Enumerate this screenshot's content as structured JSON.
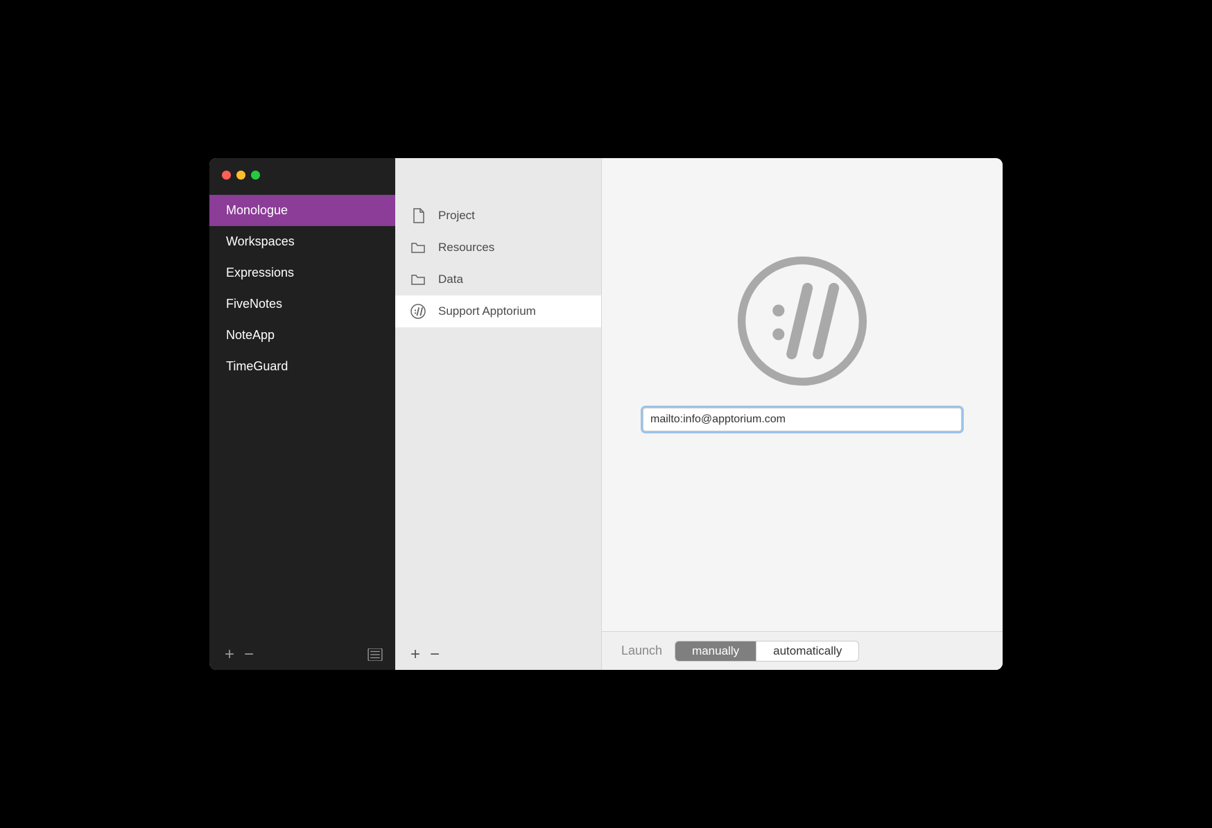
{
  "colors": {
    "accent": "#8b3d97",
    "focusRing": "#9cc3e8"
  },
  "sidebar": {
    "items": [
      {
        "label": "Monologue",
        "selected": true
      },
      {
        "label": "Workspaces",
        "selected": false
      },
      {
        "label": "Expressions",
        "selected": false
      },
      {
        "label": "FiveNotes",
        "selected": false
      },
      {
        "label": "NoteApp",
        "selected": false
      },
      {
        "label": "TimeGuard",
        "selected": false
      }
    ]
  },
  "midList": {
    "items": [
      {
        "label": "Project",
        "icon": "document-icon",
        "selected": false
      },
      {
        "label": "Resources",
        "icon": "folder-icon",
        "selected": false
      },
      {
        "label": "Data",
        "icon": "folder-icon",
        "selected": false
      },
      {
        "label": "Support Apptorium",
        "icon": "url-icon",
        "selected": true
      }
    ]
  },
  "detail": {
    "urlValue": "mailto:info@apptorium.com"
  },
  "bottomBar": {
    "launchLabel": "Launch",
    "segments": {
      "manually": "manually",
      "automatically": "automatically"
    },
    "active": "manually"
  }
}
